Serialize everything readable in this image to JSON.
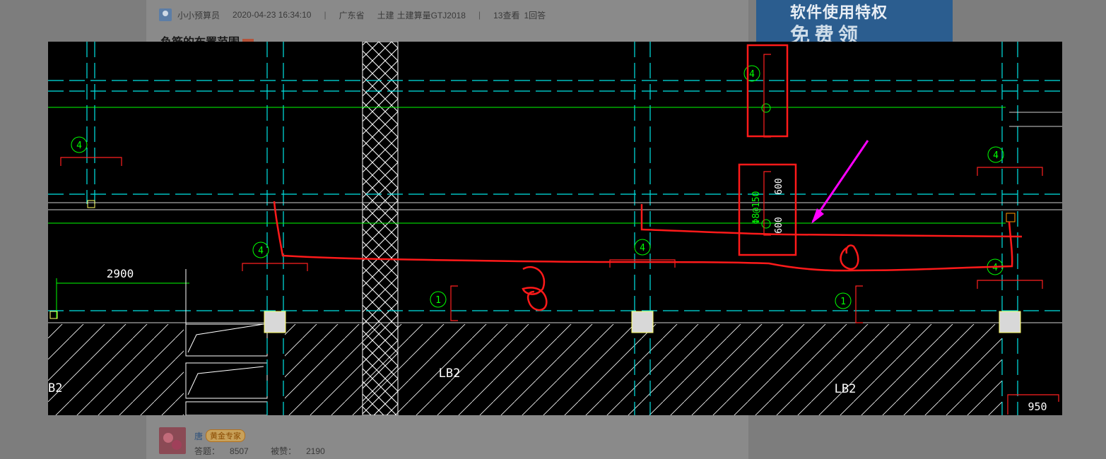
{
  "post": {
    "author": "小小预算员",
    "datetime": "2020-04-23 16:34:10",
    "separator": "|",
    "province": "广东省",
    "category": "土建",
    "software": "土建算量GTJ2018",
    "views": "13查看",
    "answers": "1回答",
    "title_partial": "负筋的布置范围"
  },
  "ad": {
    "line1": "软件使用特权",
    "line2": "免费领"
  },
  "drawing": {
    "dimension_2900": "2900",
    "dimension_950": "950",
    "slab_label_left": "LB2",
    "slab_label_right": "LB2",
    "slab_label_edge": "B2",
    "rebar_spec": "Φ8@150",
    "rebar_len_top": "600",
    "rebar_len_bottom": "600",
    "section_marks": [
      "4",
      "4",
      "4",
      "4",
      "4",
      "4",
      "1",
      "1"
    ],
    "colors": {
      "axis": "#00e5e5",
      "green": "#00ff00",
      "red": "#ff2020",
      "white": "#ffffff",
      "magenta": "#ff00ff",
      "markup": "#ff1a1a"
    }
  },
  "answer": {
    "user": "唐",
    "badge": "黄金专家",
    "answers_label": "答题：",
    "answers_count": "8507",
    "likes_label": "被赞：",
    "likes_count": "2190"
  }
}
